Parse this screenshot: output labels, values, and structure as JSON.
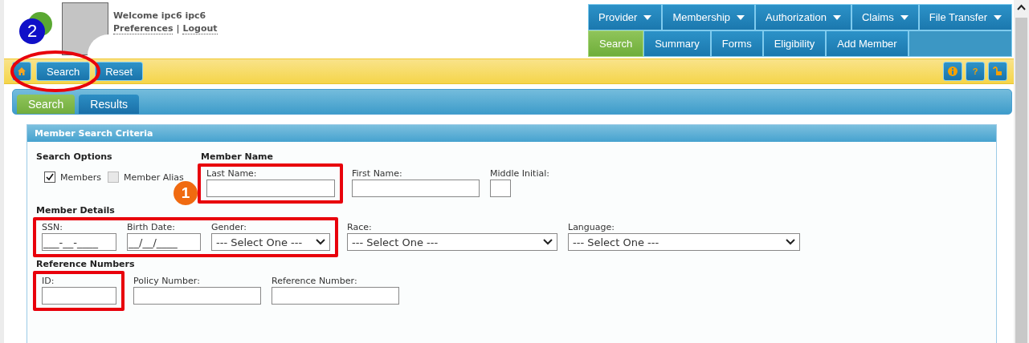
{
  "header": {
    "welcome": "Welcome ipc6 ipc6",
    "links": [
      "Preferences",
      "Logout"
    ],
    "separator": "|"
  },
  "nav": {
    "menus": [
      {
        "label": "Provider"
      },
      {
        "label": "Membership"
      },
      {
        "label": "Authorization"
      },
      {
        "label": "Claims"
      },
      {
        "label": "File Transfer"
      }
    ],
    "tabs": [
      {
        "label": "Search",
        "selected": true
      },
      {
        "label": "Summary",
        "selected": false
      },
      {
        "label": "Forms",
        "selected": false
      },
      {
        "label": "Eligibility",
        "selected": false
      },
      {
        "label": "Add Member",
        "selected": false
      }
    ]
  },
  "toolbar": {
    "buttons": [
      {
        "kind": "home"
      },
      {
        "kind": "text",
        "label": "Search"
      },
      {
        "kind": "text",
        "label": "Reset"
      }
    ],
    "right_icons": [
      {
        "kind": "info"
      },
      {
        "kind": "help",
        "label": "?"
      },
      {
        "kind": "lock"
      }
    ]
  },
  "annotation": {
    "badge": "2",
    "circle": true
  },
  "page_tabs": [
    {
      "label": "Search",
      "selected": true
    },
    {
      "label": "Results",
      "selected": false
    }
  ],
  "panel": {
    "title": "Member Search Criteria",
    "search_options": {
      "title": "Search Options",
      "options": [
        {
          "label": "Members",
          "checked": true
        },
        {
          "label": "Member Alias",
          "checked": false
        }
      ]
    },
    "sections": [
      {
        "title": "Member Name",
        "groups": [
          {
            "highlighted": true,
            "badge": "1",
            "fields": [
              {
                "label": "Last Name:",
                "kind": "text"
              }
            ]
          },
          {
            "highlighted": false,
            "fields": [
              {
                "label": "First Name:",
                "kind": "text"
              },
              {
                "label": "Middle Initial:",
                "kind": "text"
              }
            ]
          }
        ]
      },
      {
        "title": "Member Details",
        "groups": [
          {
            "highlighted": true,
            "fields": [
              {
                "label": "SSN:",
                "kind": "text",
                "value": "___-__-____"
              },
              {
                "label": "Birth Date:",
                "kind": "text",
                "value": "__/__/____"
              },
              {
                "label": "Gender:",
                "kind": "select",
                "value": "--- Select One ---"
              }
            ]
          },
          {
            "highlighted": false,
            "fields": [
              {
                "label": "Race:",
                "kind": "select",
                "value": "--- Select One ---"
              },
              {
                "label": "Language:",
                "kind": "select",
                "value": "--- Select One ---"
              }
            ]
          }
        ]
      },
      {
        "title": "Reference Numbers",
        "groups": [
          {
            "highlighted": true,
            "fields": [
              {
                "label": "ID:",
                "kind": "text"
              }
            ]
          },
          {
            "highlighted": false,
            "fields": [
              {
                "label": "Policy Number:",
                "kind": "text"
              },
              {
                "label": "Reference Number:",
                "kind": "text"
              }
            ]
          }
        ]
      }
    ]
  }
}
